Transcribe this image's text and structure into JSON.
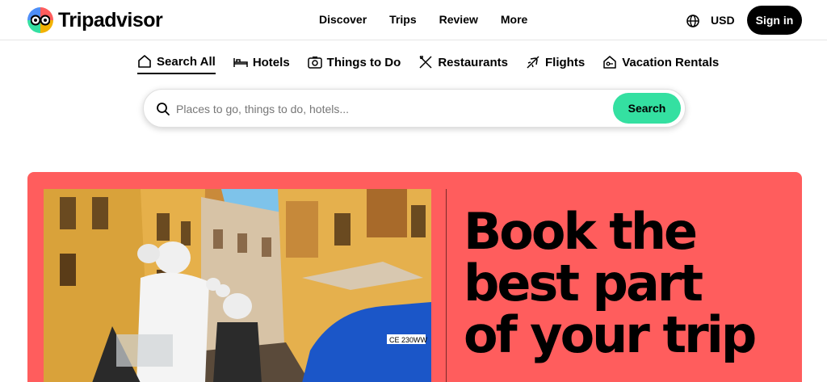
{
  "header": {
    "logo_text": "Tripadvisor",
    "nav": [
      "Discover",
      "Trips",
      "Review",
      "More"
    ],
    "currency": "USD",
    "signin_label": "Sign in"
  },
  "tabs": [
    {
      "label": "Search All",
      "icon": "home-icon",
      "active": true
    },
    {
      "label": "Hotels",
      "icon": "bed-icon",
      "active": false
    },
    {
      "label": "Things to Do",
      "icon": "camera-icon",
      "active": false
    },
    {
      "label": "Restaurants",
      "icon": "utensils-icon",
      "active": false
    },
    {
      "label": "Flights",
      "icon": "plane-icon",
      "active": false
    },
    {
      "label": "Vacation Rentals",
      "icon": "house-key-icon",
      "active": false
    }
  ],
  "search": {
    "placeholder": "Places to go, things to do, hotels...",
    "button_label": "Search"
  },
  "hero": {
    "headline_lines": [
      "Book the",
      "best part",
      "of your trip"
    ],
    "background_color": "#ff5d5d",
    "photo_plate_text": "CE 230WW"
  },
  "colors": {
    "brand_green": "#34e0a1",
    "hero_coral": "#ff5d5d",
    "text": "#000000"
  }
}
